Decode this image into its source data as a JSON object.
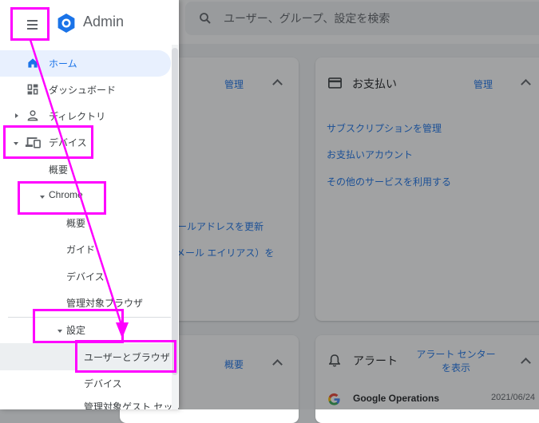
{
  "app": {
    "brand": "Admin"
  },
  "search": {
    "placeholder": "ユーザー、グループ、設定を検索"
  },
  "background": {
    "card_left_top": {
      "header_link": "管理",
      "links": [
        "メールアドレスを更新",
        "（メール エイリアス）を"
      ]
    },
    "billing_card": {
      "title": "お支払い",
      "header_link": "管理",
      "links": [
        "サブスクリプションを管理",
        "お支払いアカウント",
        "その他のサービスを利用する"
      ]
    },
    "card_left_bottom": {
      "header_link": "概要"
    },
    "alert_card": {
      "title": "アラート",
      "header_link_line1": "アラート センター",
      "header_link_line2": "を表示",
      "item_sender": "Google Operations",
      "item_date": "2021/06/24"
    }
  },
  "sidebar": {
    "home": "ホーム",
    "dashboard": "ダッシュボード",
    "directory": "ディレクトリ",
    "devices": "デバイス",
    "devices_overview": "概要",
    "chrome": "Chrome",
    "chrome_overview": "概要",
    "chrome_guide": "ガイド",
    "chrome_devices": "デバイス",
    "chrome_managed_browsers": "管理対象ブラウザ",
    "settings": "設定",
    "settings_users_browsers": "ユーザーとブラウザ",
    "settings_devices": "デバイス",
    "settings_managed_guest": "管理対象ゲスト セッション"
  },
  "colors": {
    "annotation": "#ff00ff",
    "accent": "#1a73e8"
  }
}
